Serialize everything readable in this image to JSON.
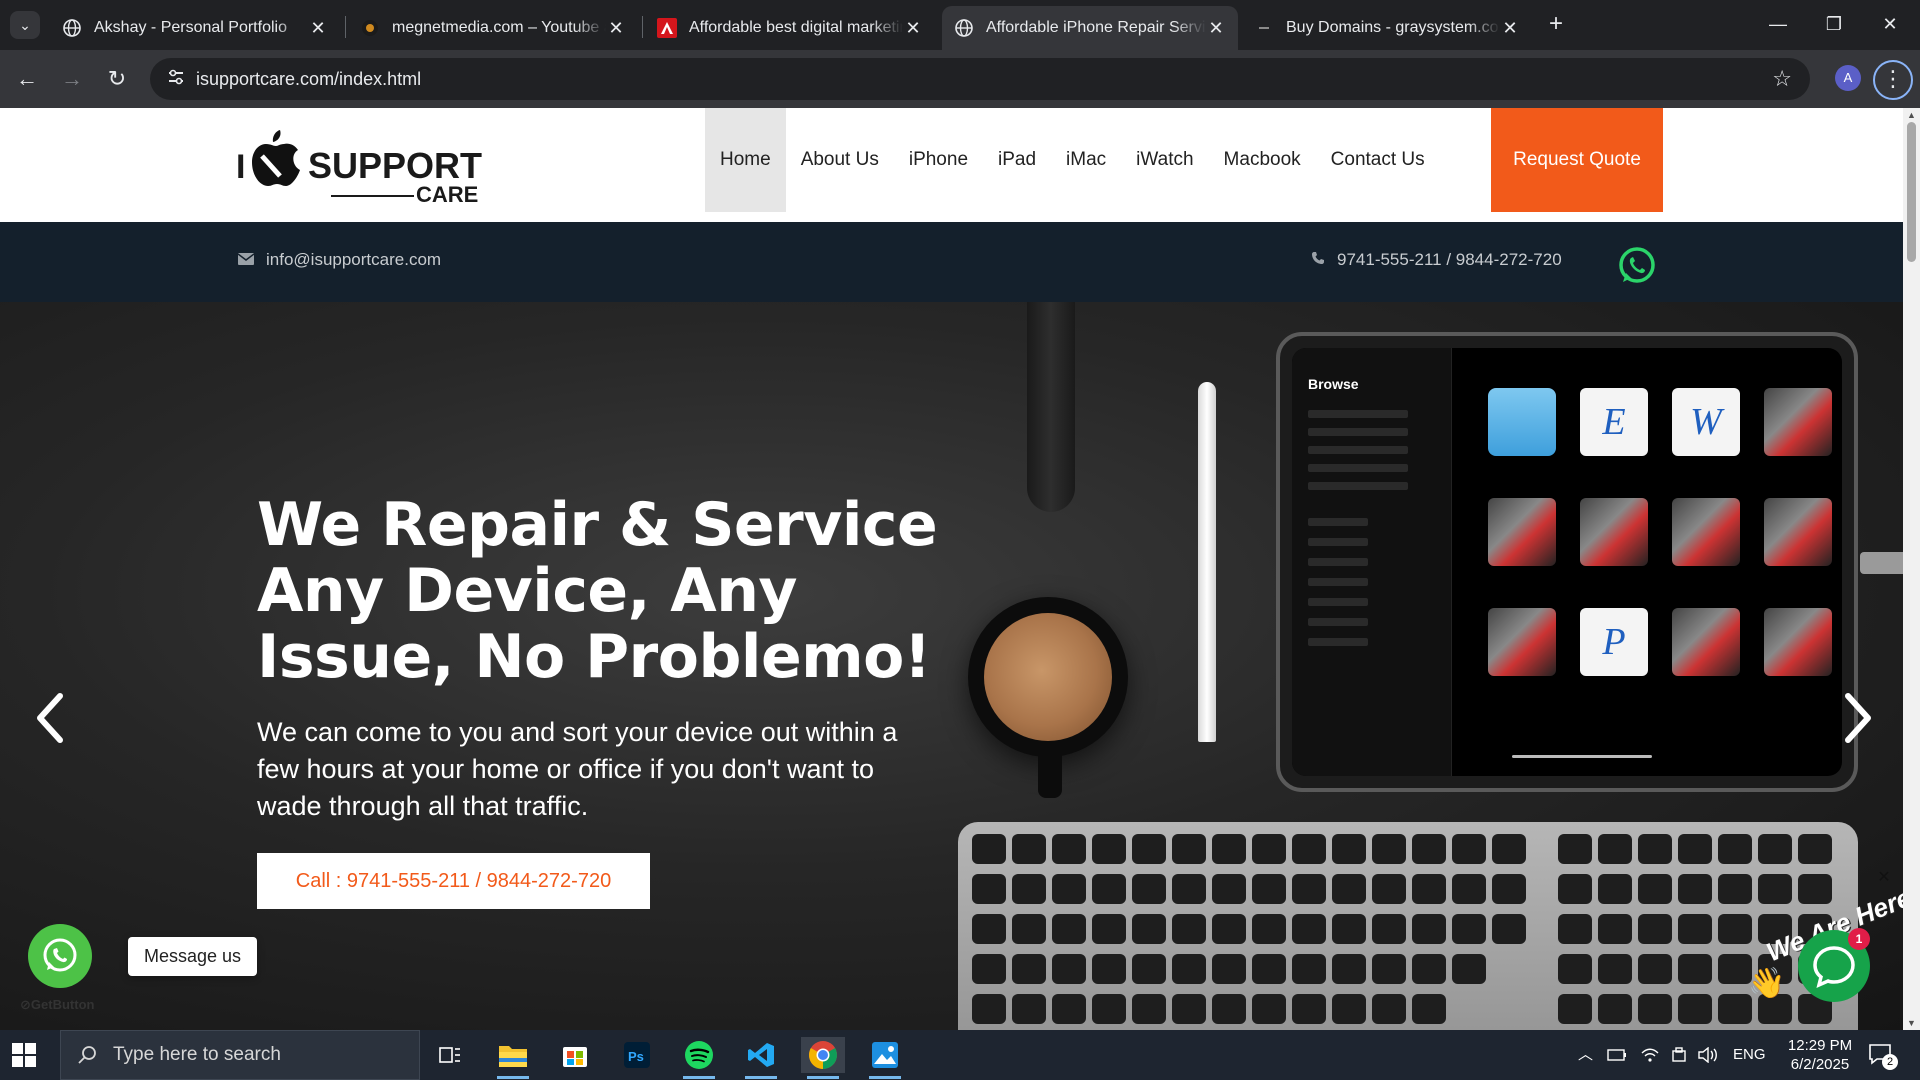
{
  "browser": {
    "tabs": [
      {
        "title": "Akshay - Personal Portfolio",
        "icon": "globe-icon",
        "active": false
      },
      {
        "title": "megnetmedia.com – Youtube a",
        "icon": "megnet-icon",
        "active": false
      },
      {
        "title": "Affordable best digital marketin",
        "icon": "adobe-icon",
        "active": false
      },
      {
        "title": "Affordable iPhone Repair Servic",
        "icon": "globe-icon",
        "active": true
      },
      {
        "title": "Buy Domains - graysystem.com",
        "icon": "dash-icon",
        "active": false
      }
    ],
    "url": "isupportcare.com/index.html",
    "profile_initial": "A"
  },
  "site": {
    "logo": {
      "line1": "I",
      "brand": "SUPPORT",
      "sub": "CARE"
    },
    "nav": [
      "Home",
      "About Us",
      "iPhone",
      "iPad",
      "iMac",
      "iWatch",
      "Macbook",
      "Contact Us"
    ],
    "active_nav": "Home",
    "quote_button": "Request Quote",
    "email": "info@isupportcare.com",
    "phone": "9741-555-211 / 9844-272-720",
    "accent": "#f25a1a",
    "topbar_bg": "#14202c"
  },
  "hero": {
    "title": "We Repair & Service Any Device, Any Issue, No Problemo!",
    "subtitle": "We can come to you and sort your device out within a few hours at your home or office if you don't want to wade through all that traffic.",
    "cta": "Call : 9741-555-211 / 9844-272-720",
    "tablet": {
      "browse_label": "Browse",
      "files": [
        "folder",
        "E",
        "W",
        "photo",
        "photo",
        "photo",
        "photo",
        "photo",
        "photo",
        "P",
        "photo",
        "photo"
      ]
    }
  },
  "widgets": {
    "message_us": "Message us",
    "getbutton": "GetButton",
    "chat_banner": "We Are Here!",
    "chat_count": "1"
  },
  "taskbar": {
    "search_placeholder": "Type here to search",
    "language": "ENG",
    "time": "12:29 PM",
    "date": "6/2/2025",
    "notifications": "2"
  }
}
